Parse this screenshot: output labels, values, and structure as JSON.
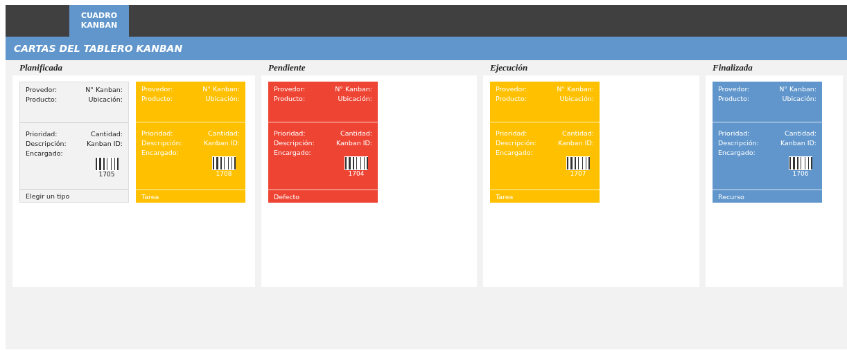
{
  "tabs": [
    {
      "label": "CUADRO\nKANBAN",
      "selected": true
    }
  ],
  "header": {
    "title": "CARTAS DEL TABLERO KANBAN"
  },
  "columns": [
    {
      "title": "Planificada",
      "cards": [
        {
          "color": "#f2f2f2",
          "top": [
            [
              "Provedor:",
              "N° Kanban:"
            ],
            [
              "Producto:",
              "Ubicación:"
            ]
          ],
          "middle": [
            [
              "Prioridad:",
              "Cantidad:"
            ],
            [
              "Descripción:",
              "Kanban ID:"
            ],
            [
              "Encargado:"
            ]
          ],
          "id": "1705",
          "type": "Elegir un tipo"
        },
        {
          "color": "#ffc000",
          "top": [
            [
              "Provedor:",
              "N° Kanban:"
            ],
            [
              "Producto:",
              "Ubicación:"
            ]
          ],
          "middle": [
            [
              "Prioridad:",
              "Cantidad:"
            ],
            [
              "Descripción:",
              "Kanban ID:"
            ],
            [
              "Encargado:"
            ]
          ],
          "id": "1708",
          "type": "Tarea"
        }
      ]
    },
    {
      "title": "Pendiente",
      "cards": [
        {
          "color": "#ee4433",
          "top": [
            [
              "Provedor:",
              "N° Kanban:"
            ],
            [
              "Producto:",
              "Ubicación:"
            ]
          ],
          "middle": [
            [
              "Prioridad:",
              "Cantidad:"
            ],
            [
              "Descripción:",
              "Kanban ID:"
            ],
            [
              "Encargado:"
            ]
          ],
          "id": "1704",
          "type": "Defecto"
        }
      ]
    },
    {
      "title": "Ejecución",
      "cards": [
        {
          "color": "#ffc000",
          "top": [
            [
              "Provedor:",
              "N° Kanban:"
            ],
            [
              "Producto:",
              "Ubicación:"
            ]
          ],
          "middle": [
            [
              "Prioridad:",
              "Cantidad:"
            ],
            [
              "Descripción:",
              "Kanban ID:"
            ],
            [
              "Encargado:"
            ]
          ],
          "id": "1707",
          "type": "Tarea"
        }
      ]
    },
    {
      "title": "Finalizada",
      "cards": [
        {
          "color": "#6096cc",
          "top": [
            [
              "Provedor:",
              "N° Kanban:"
            ],
            [
              "Producto:",
              "Ubicación:"
            ]
          ],
          "middle": [
            [
              "Prioridad:",
              "Cantidad:"
            ],
            [
              "Descripción:",
              "Kanban ID:"
            ],
            [
              "Encargado:"
            ]
          ],
          "id": "1706",
          "type": "Recurso"
        }
      ]
    }
  ]
}
